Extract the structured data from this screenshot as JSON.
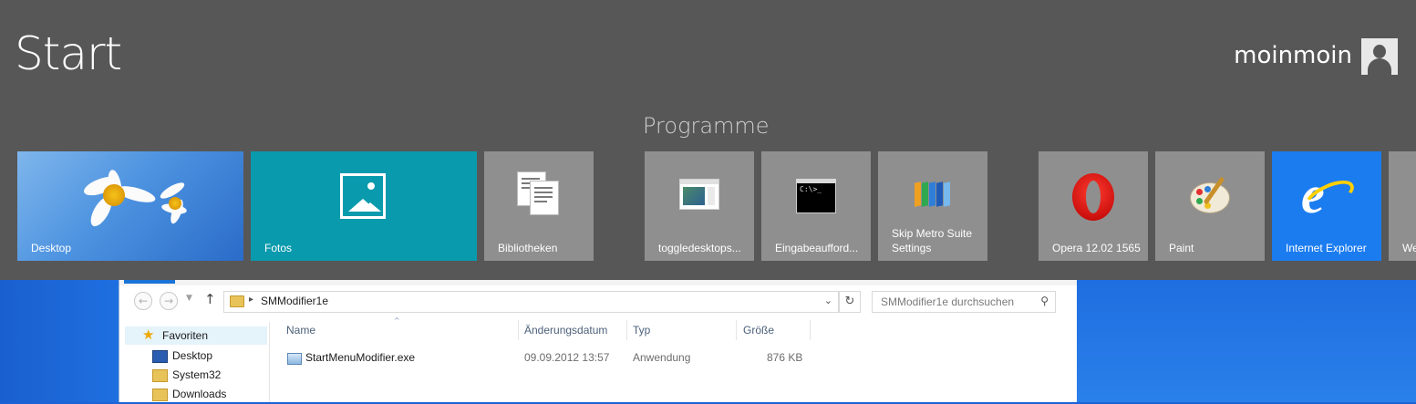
{
  "start": {
    "title": "Start",
    "user": "moinmoin",
    "group_title": "Programme"
  },
  "tiles": [
    {
      "label": "Desktop",
      "color": "#4d93e0"
    },
    {
      "label": "Fotos",
      "color": "#0a9aad"
    },
    {
      "label": "Bibliotheken",
      "color": "#8f8f8f"
    },
    {
      "label": "toggledesktops...",
      "color": "#8f8f8f"
    },
    {
      "label": "Eingabeaufford...",
      "color": "#8f8f8f"
    },
    {
      "label": "Skip Metro Suite",
      "label2": "Settings",
      "color": "#8f8f8f"
    },
    {
      "label": "Opera 12.02 1565",
      "color": "#8f8f8f"
    },
    {
      "label": "Paint",
      "color": "#8f8f8f"
    },
    {
      "label": "Internet Explorer",
      "color": "#1b7cf0"
    },
    {
      "label": "We",
      "color": "#8f8f8f"
    }
  ],
  "cmd_prompt": "C:\\>_",
  "explorer": {
    "address": "SMModifier1e",
    "search_placeholder": "SMModifier1e durchsuchen",
    "nav": {
      "favorites": "Favoriten",
      "desktop": "Desktop",
      "system32": "System32",
      "downloads": "Downloads"
    },
    "columns": [
      "Name",
      "Änderungsdatum",
      "Typ",
      "Größe"
    ],
    "files": [
      {
        "name": "StartMenuModifier.exe",
        "date": "09.09.2012 13:57",
        "type": "Anwendung",
        "size": "876 KB"
      }
    ]
  },
  "icons": {
    "back": "back-arrow-icon",
    "forward": "forward-arrow-icon",
    "up": "up-arrow-icon",
    "refresh": "refresh-icon",
    "search": "search-icon"
  }
}
